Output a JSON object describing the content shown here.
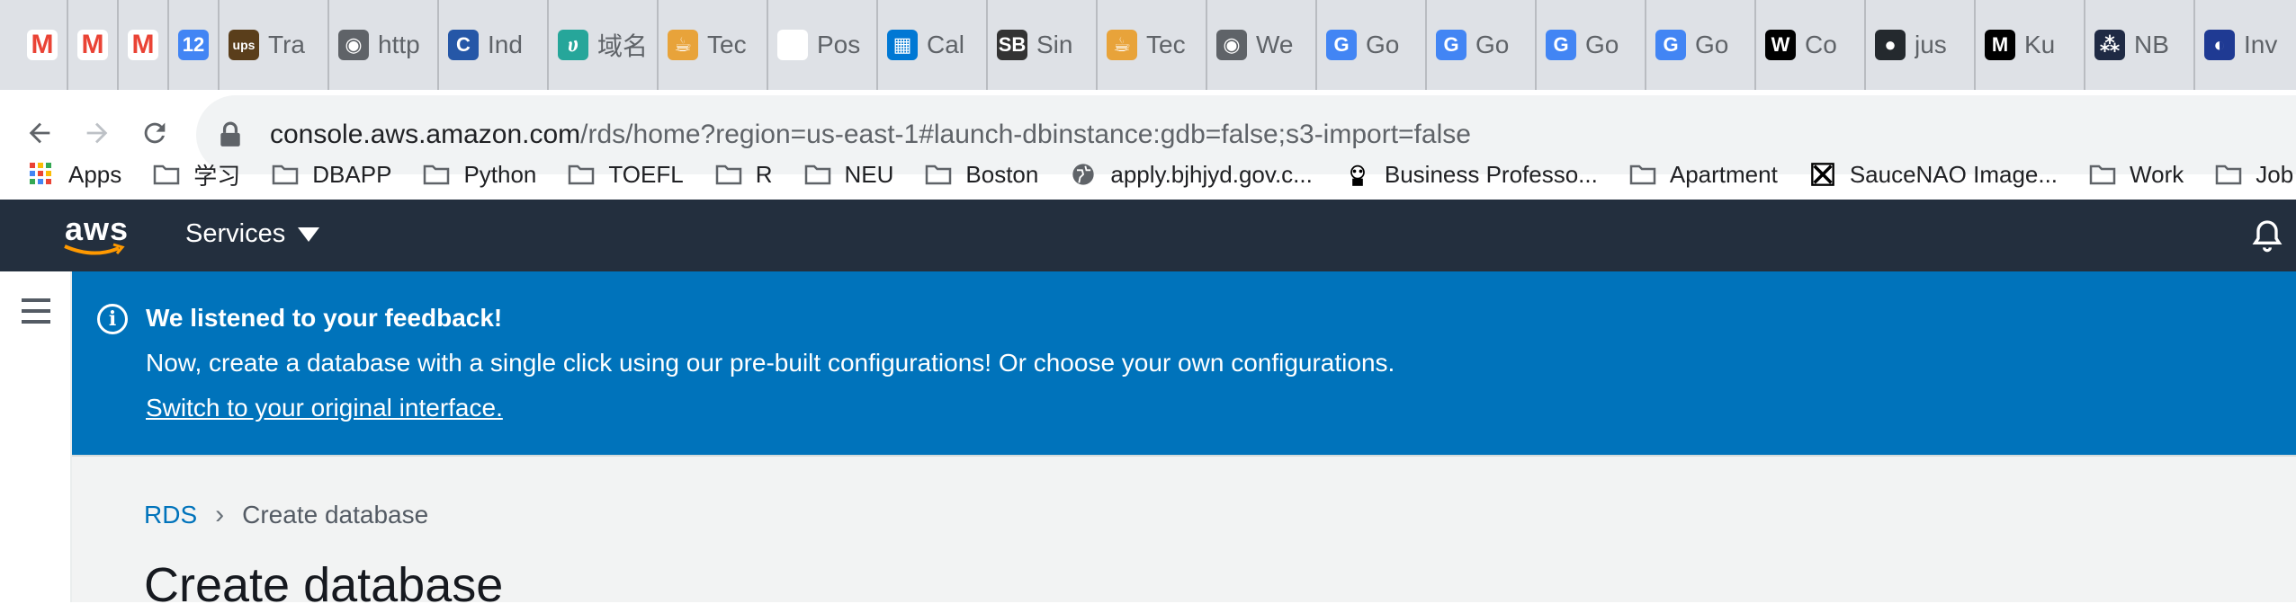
{
  "browser": {
    "tabs": [
      {
        "icon": "gmail-icon",
        "label": "",
        "color": "#ea4335"
      },
      {
        "icon": "gmail-icon",
        "label": "",
        "color": "#ea4335"
      },
      {
        "icon": "gmail-icon",
        "label": "",
        "color": "#ea4335"
      },
      {
        "icon": "calendar-icon",
        "label": "",
        "color": "#4285f4"
      },
      {
        "icon": "ups-icon",
        "label": "Tra",
        "color": "#5a3e1b"
      },
      {
        "icon": "globe-icon",
        "label": "http",
        "color": "#5f6368"
      },
      {
        "icon": "indeed-icon",
        "label": "Ind",
        "color": "#2557a7"
      },
      {
        "icon": "domain-icon",
        "label": "域名",
        "color": "#26a69a"
      },
      {
        "icon": "tencent-icon",
        "label": "Tec",
        "color": "#e8a33a"
      },
      {
        "icon": "blank-page-icon",
        "label": "Pos",
        "color": "#ffffff"
      },
      {
        "icon": "outlook-calendar-icon",
        "label": "Cal",
        "color": "#0078d4"
      },
      {
        "icon": "sb-icon",
        "label": "Sin",
        "color": "#333333"
      },
      {
        "icon": "tencent-icon",
        "label": "Tec",
        "color": "#e8a33a"
      },
      {
        "icon": "globe-icon",
        "label": "We",
        "color": "#5f6368"
      },
      {
        "icon": "google-translate-icon",
        "label": "Go",
        "color": "#4285f4"
      },
      {
        "icon": "google-translate-icon",
        "label": "Go",
        "color": "#4285f4"
      },
      {
        "icon": "google-translate-icon",
        "label": "Go",
        "color": "#4285f4"
      },
      {
        "icon": "google-translate-icon",
        "label": "Go",
        "color": "#4285f4"
      },
      {
        "icon": "wix-icon",
        "label": "Co",
        "color": "#000000"
      },
      {
        "icon": "github-icon",
        "label": "jus",
        "color": "#24292e"
      },
      {
        "icon": "medium-icon",
        "label": "Ku",
        "color": "#000000"
      },
      {
        "icon": "nb-icon",
        "label": "NB",
        "color": "#1f2a44"
      },
      {
        "icon": "inv-icon",
        "label": "Inv",
        "color": "#1f3a93"
      },
      {
        "icon": "stack-icon",
        "label": "",
        "color": "#e8594a"
      }
    ],
    "url_host": "console.aws.amazon.com",
    "url_path": "/rds/home?region=us-east-1#launch-dbinstance:gdb=false;s3-import=false",
    "bookmarks": [
      {
        "icon": "apps-grid-icon",
        "label": "Apps"
      },
      {
        "icon": "folder-icon",
        "label": "学习"
      },
      {
        "icon": "folder-icon",
        "label": "DBAPP"
      },
      {
        "icon": "folder-icon",
        "label": "Python"
      },
      {
        "icon": "folder-icon",
        "label": "TOEFL"
      },
      {
        "icon": "folder-icon",
        "label": "R"
      },
      {
        "icon": "folder-icon",
        "label": "NEU"
      },
      {
        "icon": "folder-icon",
        "label": "Boston"
      },
      {
        "icon": "globe-icon",
        "label": "apply.bjhjyd.gov.c..."
      },
      {
        "icon": "panda-icon",
        "label": "Business Professo..."
      },
      {
        "icon": "folder-icon",
        "label": "Apartment"
      },
      {
        "icon": "saucenao-icon",
        "label": "SauceNAO Image..."
      },
      {
        "icon": "folder-icon",
        "label": "Work"
      },
      {
        "icon": "folder-icon",
        "label": "Job Hun"
      }
    ]
  },
  "aws": {
    "logo_text": "aws",
    "services_label": "Services",
    "banner": {
      "title": "We listened to your feedback!",
      "text": "Now, create a database with a single click using our pre-built configurations! Or choose your own configurations.",
      "link": "Switch to your original interface."
    },
    "breadcrumb": {
      "root": "RDS",
      "current": "Create database"
    },
    "page_title": "Create database"
  }
}
